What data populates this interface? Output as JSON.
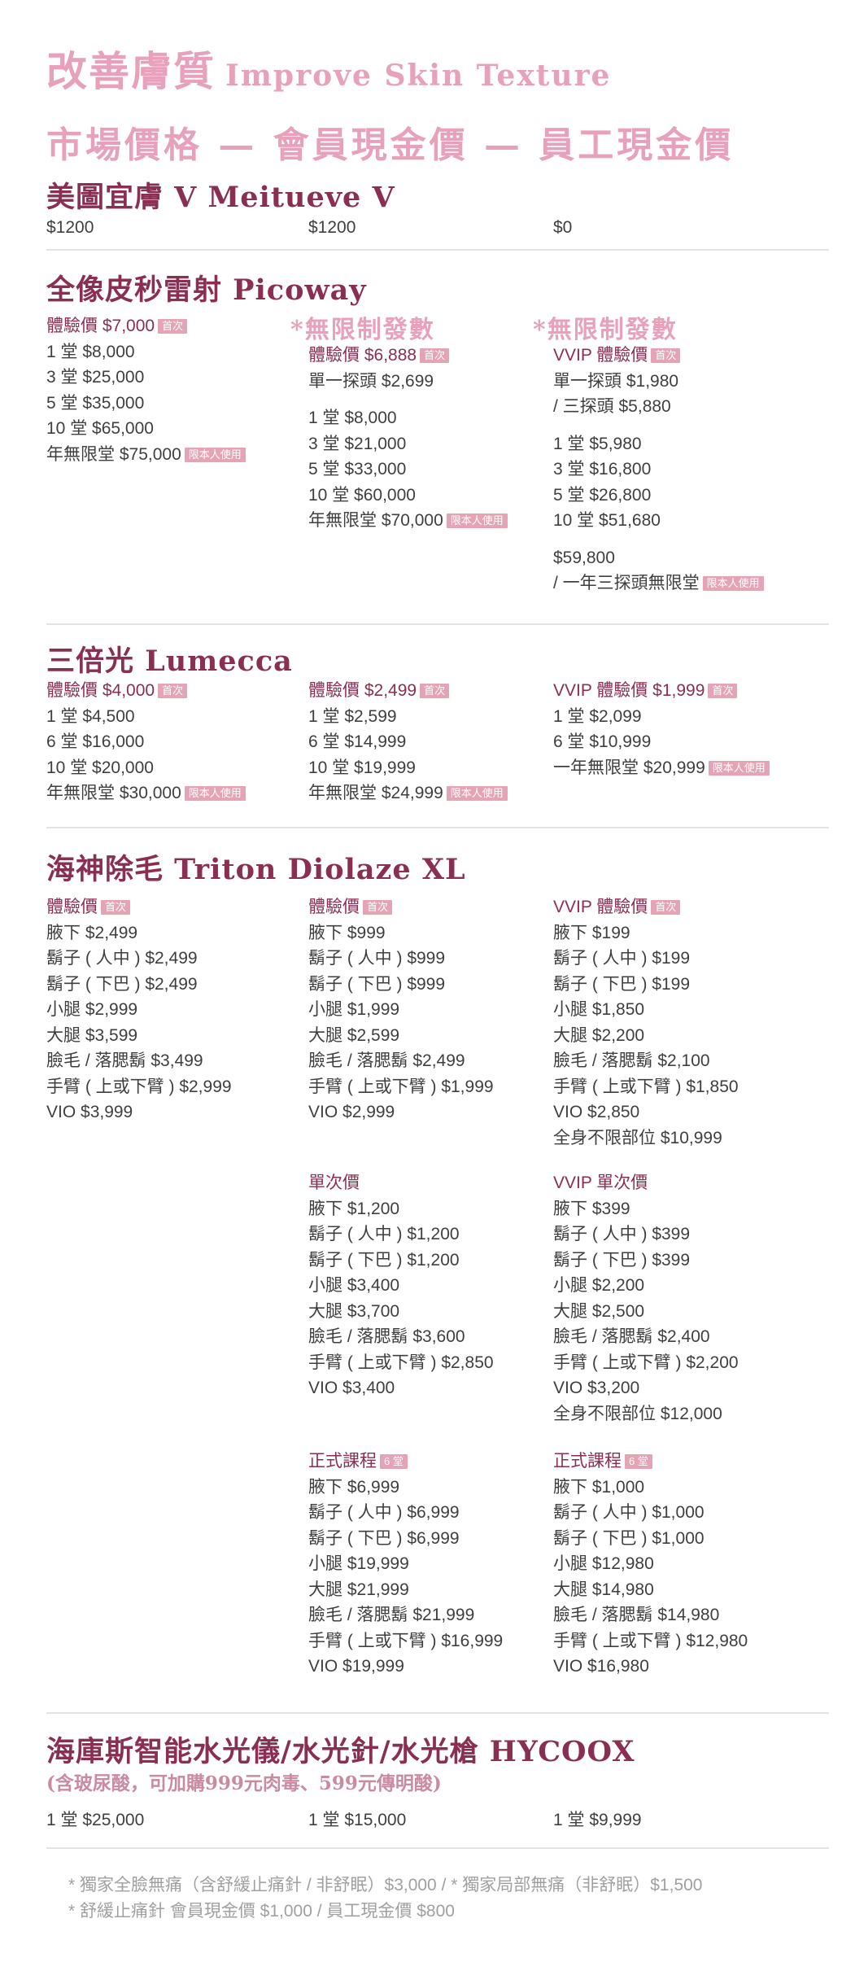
{
  "header": {
    "title_zh": "改善膚質",
    "title_en": "Improve Skin Texture",
    "subtitle": "市場價格 — 會員現金價 — 員工現金價"
  },
  "meitueve": {
    "title": "美圖宜膚 V Meitueve V",
    "prices": [
      "$1200",
      "$1200",
      "$0"
    ]
  },
  "picoway": {
    "title": "全像皮秒雷射 Picoway",
    "unlimited_label": "*無限制發數",
    "col1": {
      "trial": "體驗價 $7,000",
      "first_badge": "首次",
      "lines": [
        "1 堂 $8,000",
        "3 堂 $25,000",
        "5 堂 $35,000",
        "10 堂 $65,000"
      ],
      "yearly": "年無限堂 $75,000",
      "self_badge": "限本人使用"
    },
    "col2": {
      "trial": "體驗價 $6,888",
      "first_badge": "首次",
      "single_probe": "單一探頭 $2,699",
      "lines": [
        "1 堂 $8,000",
        "3 堂 $21,000",
        "5 堂 $33,000",
        "10 堂 $60,000"
      ],
      "yearly": "年無限堂 $70,000",
      "self_badge": "限本人使用"
    },
    "col3": {
      "trial": "VVIP 體驗價",
      "first_badge": "首次",
      "single_probe": "單一探頭 $1,980",
      "three_probe": "/ 三探頭 $5,880",
      "lines": [
        "1 堂 $5,980",
        "3 堂 $16,800",
        "5 堂 $26,800",
        "10 堂 $51,680"
      ],
      "yearly_price": "$59,800",
      "yearly": "/ 一年三探頭無限堂",
      "self_badge": "限本人使用"
    }
  },
  "lumecca": {
    "title": "三倍光 Lumecca",
    "col1": {
      "trial": "體驗價 $4,000",
      "first_badge": "首次",
      "lines": [
        "1 堂 $4,500",
        "6 堂 $16,000",
        "10 堂 $20,000"
      ],
      "yearly": "年無限堂 $30,000",
      "self_badge": "限本人使用"
    },
    "col2": {
      "trial": "體驗價 $2,499",
      "first_badge": "首次",
      "lines": [
        "1 堂 $2,599",
        "6 堂 $14,999",
        "10 堂 $19,999"
      ],
      "yearly": "年無限堂 $24,999",
      "self_badge": "限本人使用"
    },
    "col3": {
      "trial": "VVIP 體驗價 $1,999",
      "first_badge": "首次",
      "lines": [
        "1 堂 $2,099",
        "6 堂 $10,999"
      ],
      "yearly": "一年無限堂 $20,999",
      "self_badge": "限本人使用"
    }
  },
  "triton": {
    "title": "海神除毛 Triton Diolaze XL",
    "trial": {
      "col1": {
        "heading": "體驗價",
        "badge": "首次",
        "lines": [
          "腋下 $2,499",
          "鬍子 ( 人中 ) $2,499",
          "鬍子 ( 下巴 ) $2,499",
          "小腿 $2,999",
          "大腿 $3,599",
          "臉毛 / 落腮鬍 $3,499",
          "手臂 ( 上或下臂 ) $2,999",
          "VIO $3,999"
        ]
      },
      "col2": {
        "heading": "體驗價",
        "badge": "首次",
        "lines": [
          "腋下 $999",
          "鬍子 ( 人中 ) $999",
          "鬍子 ( 下巴 ) $999",
          "小腿 $1,999",
          "大腿 $2,599",
          "臉毛 / 落腮鬍 $2,499",
          "手臂 ( 上或下臂 ) $1,999",
          "VIO $2,999"
        ]
      },
      "col3": {
        "heading": "VVIP 體驗價",
        "badge": "首次",
        "lines": [
          "腋下 $199",
          "鬍子 ( 人中 ) $199",
          "鬍子 ( 下巴 ) $199",
          "小腿 $1,850",
          "大腿 $2,200",
          "臉毛 / 落腮鬍 $2,100",
          "手臂 ( 上或下臂 ) $1,850",
          "VIO $2,850",
          "全身不限部位 $10,999"
        ]
      }
    },
    "single": {
      "col2": {
        "heading": "單次價",
        "lines": [
          "腋下 $1,200",
          "鬍子 ( 人中 ) $1,200",
          "鬍子 ( 下巴 ) $1,200",
          "小腿 $3,400",
          "大腿 $3,700",
          "臉毛 / 落腮鬍 $3,600",
          "手臂 ( 上或下臂 ) $2,850",
          "VIO $3,400"
        ]
      },
      "col3": {
        "heading": "VVIP 單次價",
        "lines": [
          "腋下 $399",
          "鬍子 ( 人中 ) $399",
          "鬍子 ( 下巴 ) $399",
          "小腿 $2,200",
          "大腿 $2,500",
          "臉毛 / 落腮鬍 $2,400",
          "手臂 ( 上或下臂 ) $2,200",
          "VIO $3,200",
          "全身不限部位 $12,000"
        ]
      }
    },
    "course": {
      "col2": {
        "heading": "正式課程",
        "badge": "6 堂",
        "lines": [
          "腋下 $6,999",
          "鬍子 ( 人中 ) $6,999",
          "鬍子 ( 下巴 ) $6,999",
          "小腿 $19,999",
          "大腿 $21,999",
          "臉毛 / 落腮鬍 $21,999",
          "手臂 ( 上或下臂 ) $16,999",
          "VIO $19,999"
        ]
      },
      "col3": {
        "heading": "正式課程",
        "badge": "6 堂",
        "lines": [
          "腋下 $1,000",
          "鬍子 ( 人中 ) $1,000",
          "鬍子 ( 下巴 ) $1,000",
          "小腿 $12,980",
          "大腿 $14,980",
          "臉毛 / 落腮鬍 $14,980",
          "手臂 ( 上或下臂 ) $12,980",
          "VIO $16,980"
        ]
      }
    }
  },
  "hycoox": {
    "title": "海庫斯智能水光儀/水光針/水光槍 HYCOOX",
    "subtitle": "(含玻尿酸，可加購999元肉毒、599元傳明酸)",
    "prices": [
      "1 堂 $25,000",
      "1 堂 $15,000",
      "1 堂 $9,999"
    ]
  },
  "notes": [
    "* 獨家全臉無痛（含舒緩止痛針 / 非舒眠）$3,000  /  * 獨家局部無痛（非舒眠）$1,500",
    "* 舒緩止痛針  會員現金價 $1,000 / 員工現金價 $800"
  ],
  "colors": {
    "accent_pink": "#e7a1ba",
    "plum": "#8a2f52",
    "badge": "#e4a4b6"
  }
}
